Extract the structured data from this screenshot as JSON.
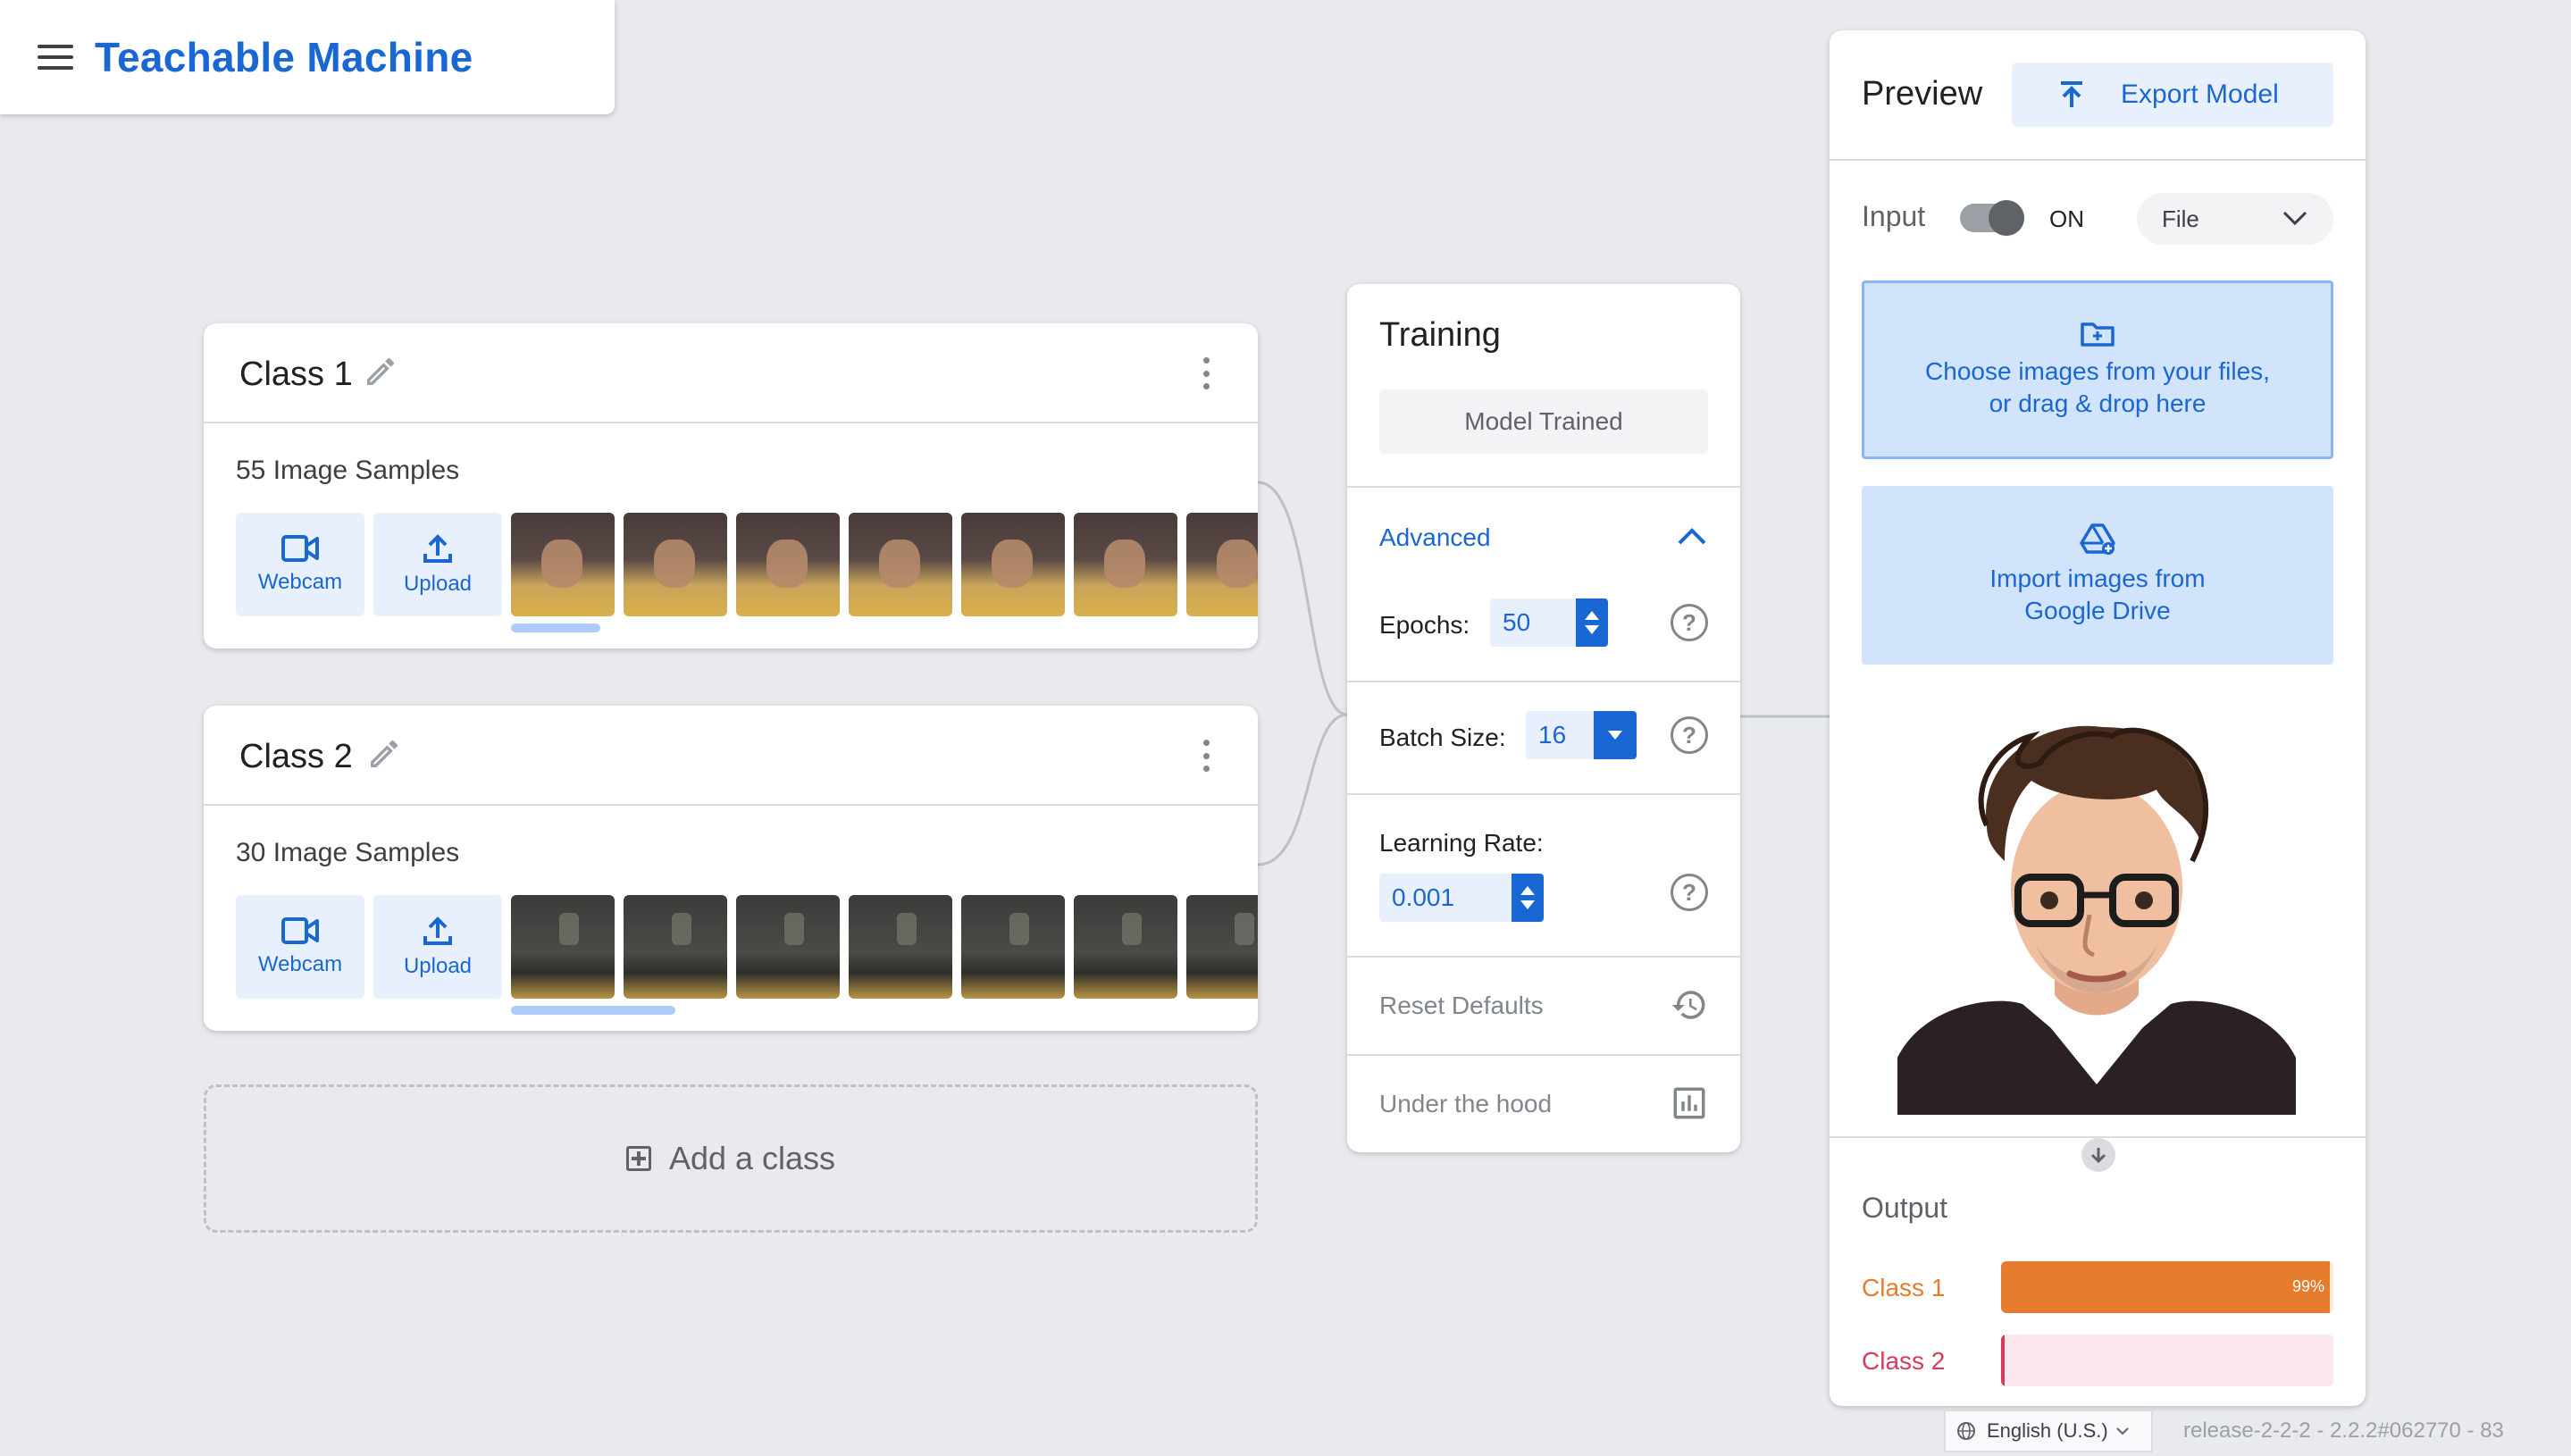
{
  "header": {
    "title": "Teachable Machine"
  },
  "classes": [
    {
      "name": "Class 1",
      "samples": "55 Image Samples",
      "webcam_label": "Webcam",
      "upload_label": "Upload"
    },
    {
      "name": "Class 2",
      "samples": "30 Image Samples",
      "webcam_label": "Webcam",
      "upload_label": "Upload"
    }
  ],
  "add_class": {
    "label": "Add a class"
  },
  "training": {
    "title": "Training",
    "status": "Model Trained",
    "advanced_label": "Advanced",
    "epochs_label": "Epochs:",
    "epochs_value": "50",
    "batch_label": "Batch Size:",
    "batch_value": "16",
    "lr_label": "Learning Rate:",
    "lr_value": "0.001",
    "reset_label": "Reset Defaults",
    "hood_label": "Under the hood",
    "help_glyph": "?"
  },
  "preview": {
    "title": "Preview",
    "export_label": "Export Model",
    "input_label": "Input",
    "toggle_state": "ON",
    "source_select": "File",
    "dropzone_line1": "Choose images from your files,",
    "dropzone_line2": "or drag & drop here",
    "drive_line1": "Import images from",
    "drive_line2": "Google Drive",
    "output_label": "Output",
    "outputs": [
      {
        "label": "Class 1",
        "percent": "99%",
        "fraction": 0.99,
        "color": "#e67c2e",
        "track": "#fce8d6"
      },
      {
        "label": "Class 2",
        "percent": "",
        "fraction": 0.01,
        "color": "#d93a5b",
        "track": "#fce8ec"
      }
    ]
  },
  "footer": {
    "language": "English (U.S.)",
    "release": "release-2-2-2 - 2.2.2#062770 - 83"
  },
  "colors": {
    "accent": "#1967d2",
    "accent_light": "#e8f0fe",
    "background": "#e8eaed"
  }
}
